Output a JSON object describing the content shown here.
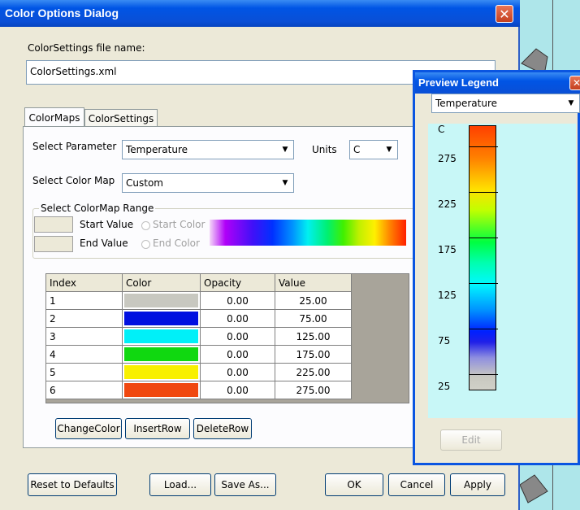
{
  "main": {
    "title": "Color Options Dialog",
    "file_label": "ColorSettings file name:",
    "file_value": "ColorSettings.xml",
    "tabs": [
      "ColorMaps",
      "ColorSettings"
    ],
    "select_parameter_label": "Select Parameter",
    "parameter_value": "Temperature",
    "units_label": "Units",
    "units_value": "C",
    "select_colormap_label": "Select Color Map",
    "colormap_value": "Custom",
    "range_group_label": "Select ColorMap Range",
    "start_value_label": "Start Value",
    "start_color_label": "Start Color",
    "end_value_label": "End Value",
    "end_color_label": "End Color",
    "table": {
      "headers": [
        "Index",
        "Color",
        "Opacity",
        "Value"
      ],
      "rows": [
        {
          "index": "1",
          "color": "#c8c8c0",
          "opacity": "0.00",
          "value": "25.00"
        },
        {
          "index": "2",
          "color": "#0010e0",
          "opacity": "0.00",
          "value": "75.00"
        },
        {
          "index": "3",
          "color": "#00f0f8",
          "opacity": "0.00",
          "value": "125.00"
        },
        {
          "index": "4",
          "color": "#10d810",
          "opacity": "0.00",
          "value": "175.00"
        },
        {
          "index": "5",
          "color": "#f8f000",
          "opacity": "0.00",
          "value": "225.00"
        },
        {
          "index": "6",
          "color": "#f04810",
          "opacity": "0.00",
          "value": "275.00"
        }
      ]
    },
    "table_buttons": [
      "ChangeColor",
      "InsertRow",
      "DeleteRow"
    ],
    "footer_buttons": {
      "reset": "Reset to Defaults",
      "load": "Load...",
      "save_as": "Save As...",
      "ok": "OK",
      "cancel": "Cancel",
      "apply": "Apply"
    }
  },
  "legend": {
    "title": "Preview Legend",
    "parameter": "Temperature",
    "unit": "C",
    "ticks": [
      "275",
      "225",
      "175",
      "125",
      "75",
      "25"
    ],
    "edit_label": "Edit"
  },
  "colors": {
    "titlebar": "#0a4fd6",
    "dialog_bg": "#ece9d8",
    "legend_bg": "#c8f7f7"
  }
}
